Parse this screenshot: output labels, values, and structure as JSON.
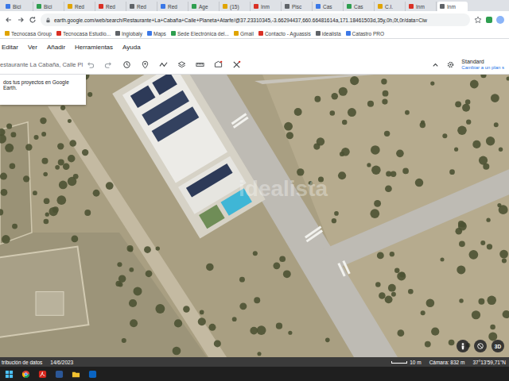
{
  "browser": {
    "tabs": [
      {
        "label": "Bici",
        "selected": false
      },
      {
        "label": "Bici",
        "selected": false
      },
      {
        "label": "Red",
        "selected": false
      },
      {
        "label": "Red",
        "selected": false
      },
      {
        "label": "Red",
        "selected": false
      },
      {
        "label": "Red",
        "selected": false
      },
      {
        "label": "Age",
        "selected": false
      },
      {
        "label": "(15)",
        "selected": false
      },
      {
        "label": "Inm",
        "selected": false
      },
      {
        "label": "Pisc",
        "selected": false
      },
      {
        "label": "Cas",
        "selected": false
      },
      {
        "label": "Cas",
        "selected": false
      },
      {
        "label": "C.I.",
        "selected": false
      },
      {
        "label": "Inm",
        "selected": false
      },
      {
        "label": "Inm",
        "selected": true
      }
    ],
    "url": "earth.google.com/web/search/Restaurante+La+Cabaña+Calle+Planeta+Atarfe/@37.23310345,-3.66294437,660.66481614a,171.18461503d,35y,0h,0t,0r/data=Ciw",
    "bookmarks": [
      "Tecnocasa Group",
      "Tecnocasa Estudio...",
      "Inglobaly",
      "Maps",
      "Sede Electrónica del...",
      "Gmail",
      "Contacto - Aguassis",
      "idealista",
      "Catastro PRO"
    ]
  },
  "earth": {
    "menu": [
      "Editar",
      "Ver",
      "Añadir",
      "Herramientas",
      "Ayuda"
    ],
    "search": "estaurante La Cabaña, Calle Pl",
    "plan": {
      "name": "Standard",
      "cta": "Cambiar a un plan s"
    },
    "tip": "dos tus proyectos en Google Earth.",
    "watermark": "idealista",
    "controls": {
      "view_3d": "3D"
    },
    "status": {
      "attribution": "tribución de datos",
      "date": "14/6/2023",
      "scale": "10 m",
      "camera": "Cámara: 832 m",
      "coords": "37°13'59,71\"N"
    }
  }
}
